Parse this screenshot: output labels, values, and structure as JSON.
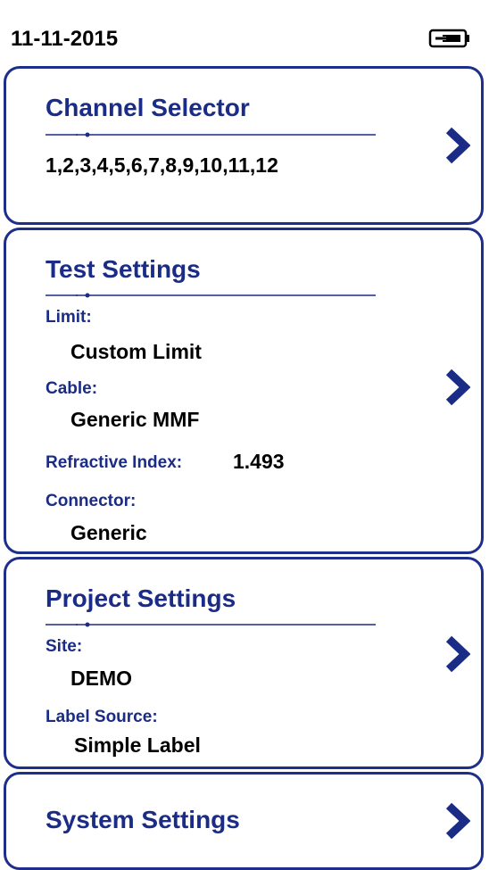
{
  "status_bar": {
    "date": "11-11-2015",
    "battery_icon": "battery-plug-icon"
  },
  "channel_selector": {
    "title": "Channel Selector",
    "channels": "1,2,3,4,5,6,7,8,9,10,11,12"
  },
  "test_settings": {
    "title": "Test Settings",
    "limit_label": "Limit:",
    "limit_value": "Custom Limit",
    "cable_label": "Cable:",
    "cable_value": "Generic MMF",
    "refractive_index_label": "Refractive Index:",
    "refractive_index_value": "1.493",
    "connector_label": "Connector:",
    "connector_value": "Generic"
  },
  "project_settings": {
    "title": "Project Settings",
    "site_label": "Site:",
    "site_value": "DEMO",
    "label_source_label": "Label Source:",
    "label_source_value": "Simple Label"
  },
  "system_settings": {
    "title": "System Settings"
  },
  "colors": {
    "accent": "#1a2c86",
    "border": "#1e2f8a",
    "text": "#000000"
  },
  "icons": {
    "chevron": "chevron-right-icon"
  }
}
